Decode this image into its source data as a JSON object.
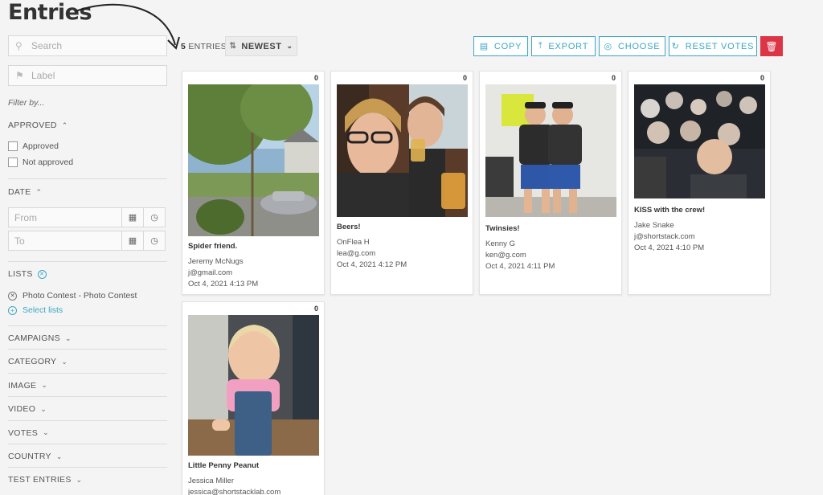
{
  "page": {
    "title": "Entries"
  },
  "sidebar": {
    "search_placeholder": "Search",
    "label_placeholder": "Label",
    "filter_by": "Filter by...",
    "approved": {
      "heading": "APPROVED",
      "options": [
        "Approved",
        "Not approved"
      ]
    },
    "date": {
      "heading": "DATE",
      "from_placeholder": "From",
      "to_placeholder": "To"
    },
    "lists": {
      "heading": "LISTS",
      "selected": "Photo Contest - Photo Contest",
      "select_label": "Select lists"
    },
    "sections": [
      "CAMPAIGNS",
      "CATEGORY",
      "IMAGE",
      "VIDEO",
      "VOTES",
      "COUNTRY",
      "TEST ENTRIES"
    ]
  },
  "toolbar": {
    "count_number": "5",
    "count_label": "ENTRIES",
    "sort_label": "NEWEST",
    "copy_label": "COPY",
    "export_label": "EXPORT",
    "choose_label": "CHOOSE",
    "reset_label": "RESET VOTES"
  },
  "entries": [
    {
      "votes": "0",
      "title": "Spider friend.",
      "name": "Jeremy McNugs",
      "email": "j@gmail.com",
      "date": "Oct 4, 2021 4:13 PM"
    },
    {
      "votes": "0",
      "title": "Beers!",
      "name": "OnFlea H",
      "email": "lea@g.com",
      "date": "Oct 4, 2021 4:12 PM"
    },
    {
      "votes": "0",
      "title": "Twinsies!",
      "name": "Kenny G",
      "email": "ken@g.com",
      "date": "Oct 4, 2021 4:11 PM"
    },
    {
      "votes": "0",
      "title": "KISS with the crew!",
      "name": "Jake Snake",
      "email": "j@shortstack.com",
      "date": "Oct 4, 2021 4:10 PM"
    },
    {
      "votes": "0",
      "title": "Little Penny Peanut",
      "name": "Jessica Miller",
      "email": "jessica@shortstacklab.com",
      "date": ""
    }
  ],
  "colors": {
    "accent": "#3ba7c2",
    "danger": "#dc3545"
  }
}
